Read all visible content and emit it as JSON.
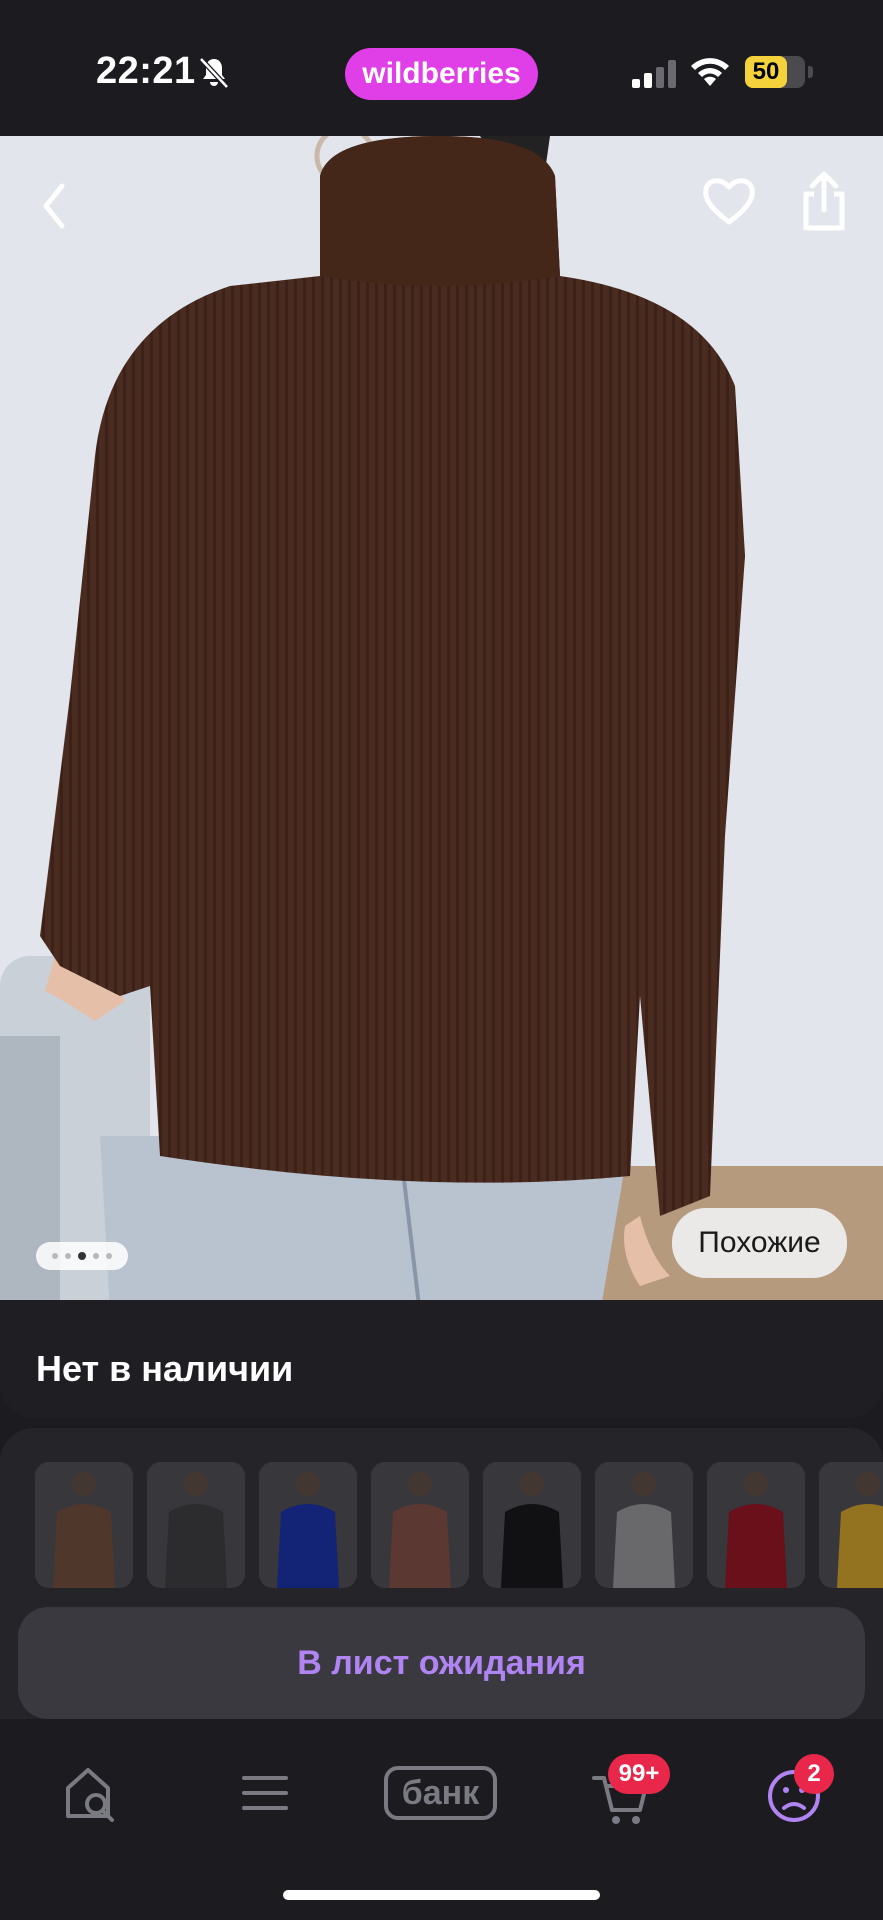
{
  "status_bar": {
    "time": "22:21",
    "brand": "wildberries",
    "battery_level": "50",
    "icons": [
      "bell-slash-icon",
      "cellular-signal-icon",
      "wifi-icon",
      "battery-icon"
    ]
  },
  "product": {
    "image_description_icon": "photo",
    "pagination_active_index": 2,
    "pagination_count": 5,
    "similar_label": "Похожие",
    "stock_status": "Нет в наличии"
  },
  "header_icons": {
    "back": "chevron-left-icon",
    "favorite": "heart-icon",
    "share": "share-icon"
  },
  "similar_items": {
    "thumbnails": [
      {
        "color": "#6b4a3a"
      },
      {
        "color": "#3b3a3c"
      },
      {
        "color": "#1a2f9e"
      },
      {
        "color": "#7a4b42"
      },
      {
        "color": "#17161a"
      },
      {
        "color": "#8d8c90"
      },
      {
        "color": "#8e1625"
      },
      {
        "color": "#c49a2a"
      }
    ]
  },
  "action_button": {
    "label": "В лист ожидания"
  },
  "tab_bar": {
    "tabs": [
      {
        "name": "home-search",
        "icon": "home-search-icon"
      },
      {
        "name": "catalog",
        "icon": "menu-icon"
      },
      {
        "name": "bank",
        "label": "банк"
      },
      {
        "name": "cart",
        "icon": "cart-icon",
        "badge": "99+"
      },
      {
        "name": "profile",
        "icon": "profile-icon",
        "badge": "2"
      }
    ]
  },
  "colors": {
    "brand": "#e03ee6",
    "accent": "#b184f4",
    "badge": "#e8274a",
    "background": "#1c1b20"
  }
}
